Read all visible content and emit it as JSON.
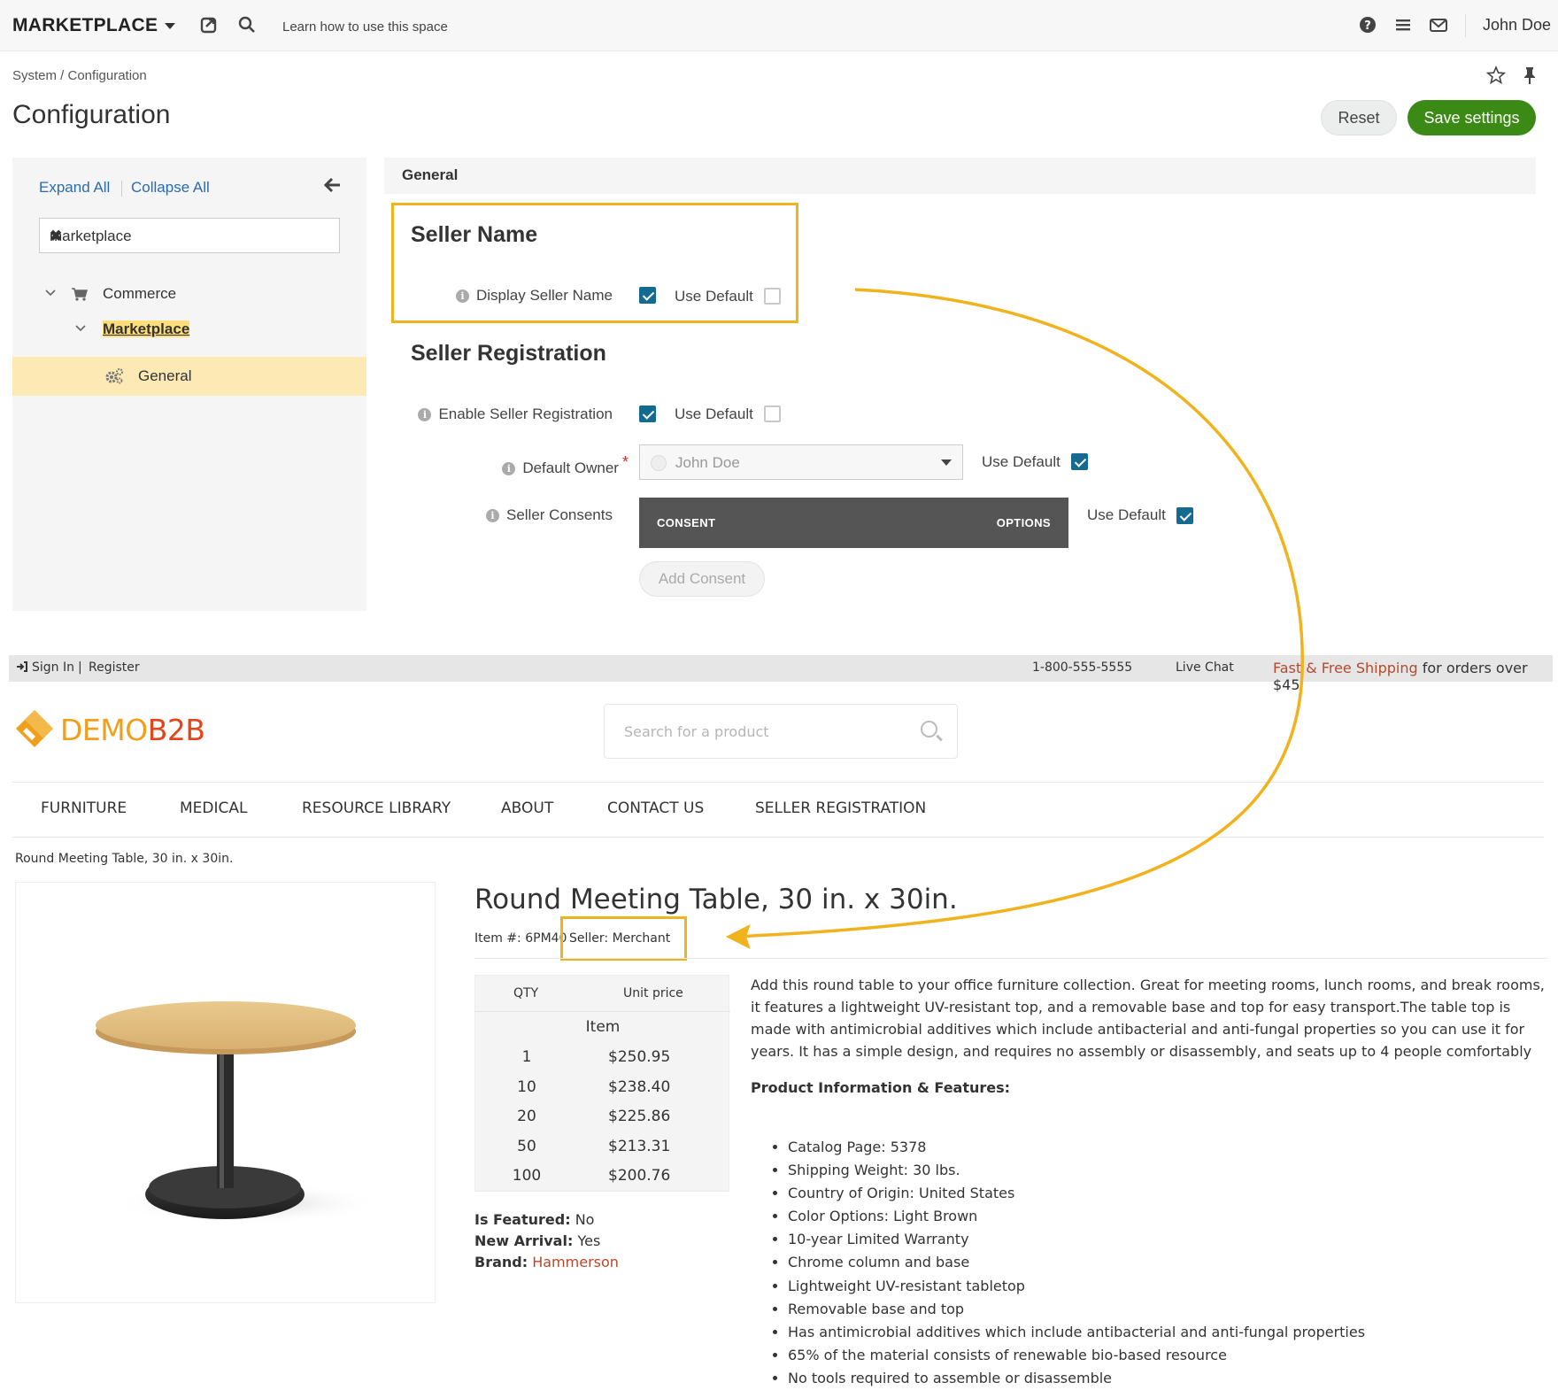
{
  "admin": {
    "app_title": "MARKETPLACE",
    "help_link": "Learn how to use this space",
    "user_name": "John Doe",
    "breadcrumb": "System / Configuration",
    "page_title": "Configuration",
    "reset_label": "Reset",
    "save_label": "Save settings",
    "icons": [
      "external-link-icon",
      "search-icon",
      "help-icon",
      "menu-icon",
      "mail-icon",
      "star-icon",
      "pin-icon"
    ]
  },
  "sidebar": {
    "expand_all": "Expand All",
    "collapse_all": "Collapse All",
    "search_value": "marketplace",
    "tree": {
      "commerce": "Commerce",
      "marketplace": "Marketplace",
      "general": "General"
    }
  },
  "general": {
    "section_title": "General",
    "seller_name": {
      "title": "Seller Name",
      "display_label": "Display Seller Name",
      "display_checked": true,
      "use_default_label": "Use Default",
      "use_default_checked": false
    },
    "seller_registration": {
      "title": "Seller Registration",
      "enable_label": "Enable Seller Registration",
      "enable_checked": true,
      "enable_use_default": false,
      "owner_label": "Default Owner",
      "owner_required": "*",
      "owner_value": "John Doe",
      "owner_use_default": true,
      "consents_label": "Seller Consents",
      "consent_col": "CONSENT",
      "options_col": "OPTIONS",
      "consents_use_default": true,
      "add_consent": "Add Consent",
      "use_default_label": "Use Default"
    }
  },
  "storefront": {
    "sign_in": "Sign In",
    "separator": "|",
    "register": "Register",
    "phone": "1-800-555-5555",
    "live_chat": "Live Chat",
    "shipping_accent": "Fast & Free Shipping",
    "shipping_rest": " for orders over $45",
    "logo_demo": "DEMO",
    "logo_b2b": "B2B",
    "search_placeholder": "Search for a product",
    "nav": [
      "FURNITURE",
      "MEDICAL",
      "RESOURCE LIBRARY",
      "ABOUT",
      "CONTACT US",
      "SELLER REGISTRATION"
    ],
    "breadcrumb": "Round Meeting Table, 30 in. x 30in.",
    "product": {
      "title": "Round Meeting Table, 30 in. x 30in.",
      "item_no": "Item #: 6PM40",
      "seller": "Seller: Merchant",
      "price_headers": {
        "qty": "QTY",
        "unit_price": "Unit price",
        "unit": "Item"
      },
      "prices": [
        {
          "qty": "1",
          "price": "$250.95"
        },
        {
          "qty": "10",
          "price": "$238.40"
        },
        {
          "qty": "20",
          "price": "$225.86"
        },
        {
          "qty": "50",
          "price": "$213.31"
        },
        {
          "qty": "100",
          "price": "$200.76"
        }
      ],
      "is_featured_label": "Is Featured:",
      "is_featured": " No",
      "new_arrival_label": "New Arrival:",
      "new_arrival": " Yes",
      "brand_label": "Brand:",
      "brand": " Hammerson",
      "description": "Add this round table to your office furniture collection. Great for meeting rooms, lunch rooms, and break rooms, it features a lightweight UV-resistant top, and a removable base and top for easy transport.The table top is made with antimicrobial additives which include antibacterial and anti-fungal properties so you can use it for years. It has a simple design, and requires no assembly or disassembly, and seats up to 4 people comfortably",
      "features_title": "Product Information & Features:",
      "features": [
        "Catalog Page: 5378",
        "Shipping Weight: 30 lbs.",
        "Country of Origin: United States",
        "Color Options: Light Brown",
        "10-year Limited Warranty",
        "Chrome column and base",
        "Lightweight UV-resistant tabletop",
        "Removable base and top",
        "Has antimicrobial additives which include antibacterial and anti-fungal properties",
        "65% of the material consists of renewable bio-based resource",
        "No tools required to assemble or disassemble"
      ]
    }
  },
  "colors": {
    "highlight_box": "#f0b21d",
    "save_button": "#3c8a16",
    "checkbox_on": "#146b8f",
    "tree_active": "#fde9b4",
    "brand_accent": "#b54a2a"
  }
}
